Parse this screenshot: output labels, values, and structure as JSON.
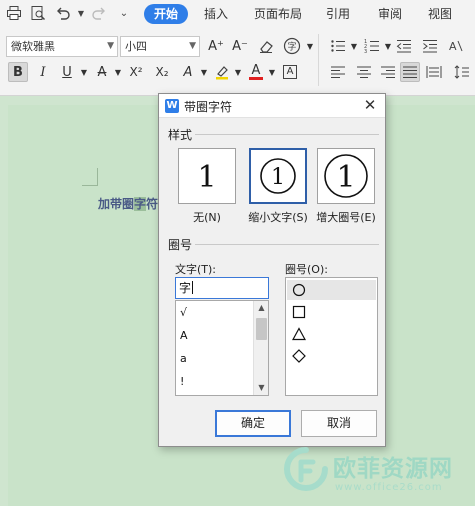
{
  "tabs": [
    "开始",
    "插入",
    "页面布局",
    "引用",
    "审阅",
    "视图"
  ],
  "active_tab": "开始",
  "font": {
    "name": "微软雅黑",
    "size": "小四"
  },
  "toolbar": {
    "bold": "B",
    "italic": "I",
    "underline": "U",
    "strikethrough": "A",
    "superscript": "X²",
    "subscript": "X₂",
    "char_shading": "A",
    "font_color": "A",
    "char_border": "A",
    "grow_font": "A⁺",
    "shrink_font": "A⁻",
    "enclose_char": "字"
  },
  "document": {
    "text_before": "加带圈",
    "text_selected": "字",
    "text_after": "符"
  },
  "dialog": {
    "title": "带圈字符",
    "close": "✕",
    "style_group": "样式",
    "styles": [
      {
        "label": "无(N)",
        "sample": "1"
      },
      {
        "label": "缩小文字(S)",
        "sample": "1"
      },
      {
        "label": "增大圈号(E)",
        "sample": "1"
      }
    ],
    "selected_style": 1,
    "enclosure_group": "圈号",
    "text_label": "文字(T):",
    "text_value": "字",
    "text_options": [
      "√",
      "A",
      "a",
      "!"
    ],
    "enclosure_label": "圈号(O):",
    "enclosure_options": [
      "circle",
      "square",
      "triangle",
      "diamond"
    ],
    "selected_enclosure": 0,
    "ok": "确定",
    "cancel": "取消"
  },
  "watermark": {
    "name": "欧菲资源网",
    "url": "www.office26.com"
  },
  "colors": {
    "accent": "#2f7ee8",
    "doc_background": "#cfe5cf",
    "selection": "#2f5fa8",
    "watermark": "#9fd8c4"
  }
}
